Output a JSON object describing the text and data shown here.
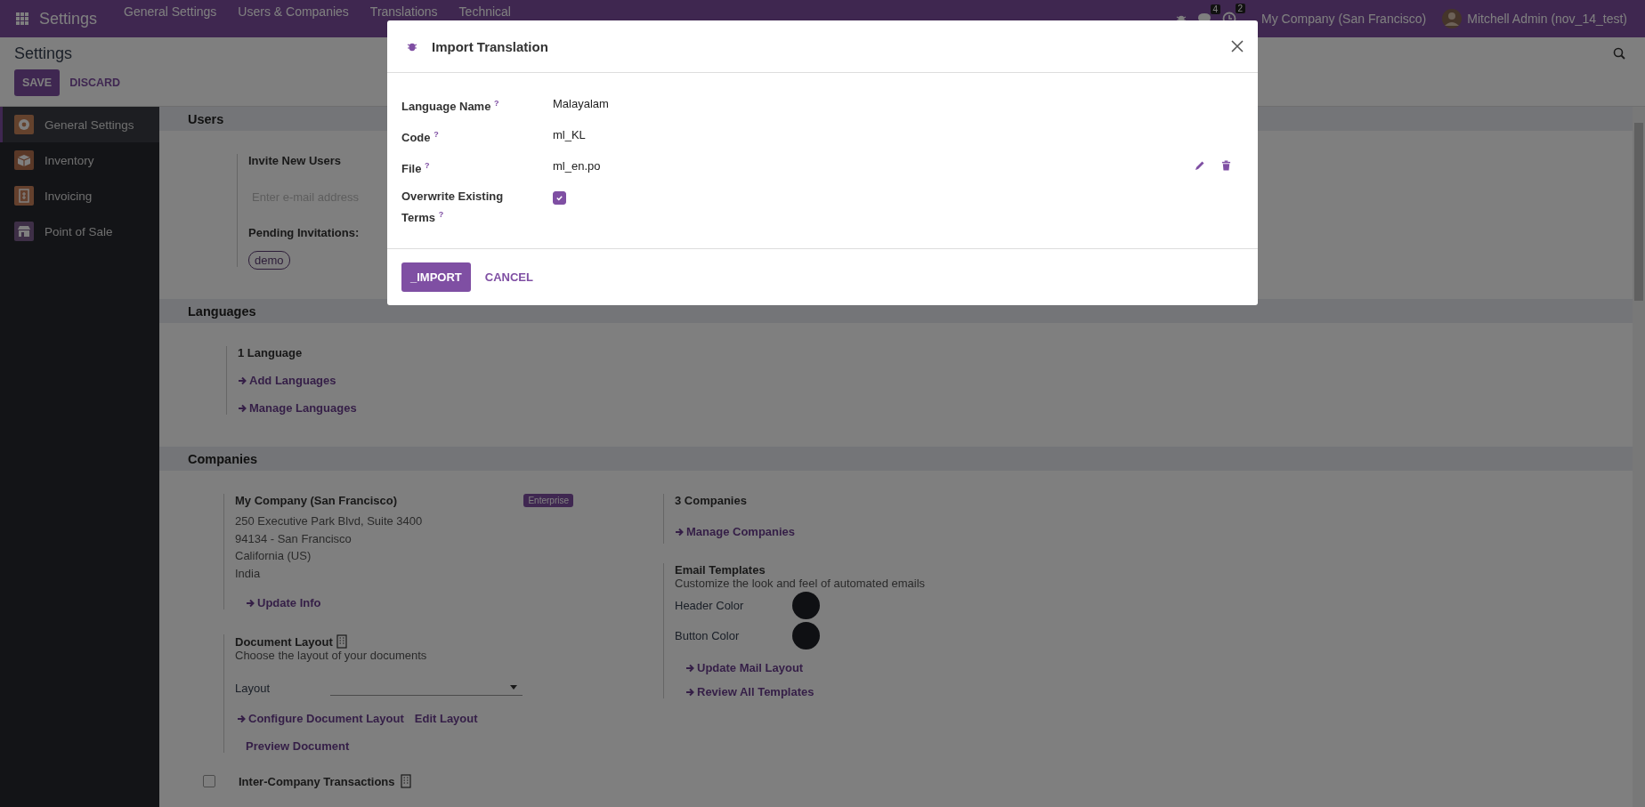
{
  "top_bar": {
    "app_name": "Settings",
    "menu": [
      "General Settings",
      "Users & Companies",
      "Translations",
      "Technical"
    ],
    "messages_badge": "4",
    "activities_badge": "2",
    "company": "My Company (San Francisco)",
    "user": "Mitchell Admin (nov_14_test)"
  },
  "control_panel": {
    "title": "Settings",
    "save": "SAVE",
    "discard": "DISCARD"
  },
  "sidebar": {
    "items": [
      {
        "label": "General Settings",
        "kind": "settings",
        "selected": true
      },
      {
        "label": "Inventory",
        "kind": "inventory",
        "selected": false
      },
      {
        "label": "Invoicing",
        "kind": "invoicing",
        "selected": false
      },
      {
        "label": "Point of Sale",
        "kind": "pos",
        "selected": false
      }
    ]
  },
  "users": {
    "heading": "Users",
    "invite_title": "Invite New Users",
    "email_placeholder": "Enter e-mail address",
    "pending_label": "Pending Invitations:",
    "pending": [
      "demo"
    ]
  },
  "languages": {
    "heading": "Languages",
    "count": "1 Language",
    "links": [
      "Add Languages",
      "Manage Languages"
    ]
  },
  "companies": {
    "heading": "Companies",
    "company_name": "My Company (San Francisco)",
    "badge": "Enterprise",
    "address": [
      "250 Executive Park Blvd, Suite 3400",
      "94134 - San Francisco",
      "California (US)",
      "India"
    ],
    "update_link": "Update Info",
    "document_layout": {
      "title": "Document Layout",
      "description": "Choose the layout of your documents",
      "layout_label": "Layout",
      "configure_link": "Configure Document Layout",
      "edit_link": "Edit Layout",
      "preview_link": "Preview Document"
    },
    "companies_count": "3 Companies",
    "manage_link": "Manage Companies",
    "email_templates": {
      "title": "Email Templates",
      "description": "Customize the look and feel of automated emails",
      "colors": [
        {
          "label": "Header Color",
          "color": "#1e2026"
        },
        {
          "label": "Button Color",
          "color": "#1e2026"
        }
      ],
      "links": [
        "Update Mail Layout",
        "Review All Templates"
      ]
    },
    "inter_company": {
      "title": "Inter-Company Transactions",
      "checked": false
    }
  },
  "dialog": {
    "title": "Import Translation",
    "fields": [
      {
        "label": "Language Name",
        "help": "?",
        "kind": "text",
        "value": "Malayalam"
      },
      {
        "label": "Code",
        "help": "?",
        "kind": "text",
        "value": "ml_KL"
      },
      {
        "label": "File",
        "help": "?",
        "kind": "file",
        "value": "ml_en.po"
      },
      {
        "label": "Overwrite Existing Terms",
        "help": "?",
        "kind": "checkbox",
        "checked": true
      }
    ],
    "primary": "_IMPORT",
    "secondary": "CANCEL"
  }
}
